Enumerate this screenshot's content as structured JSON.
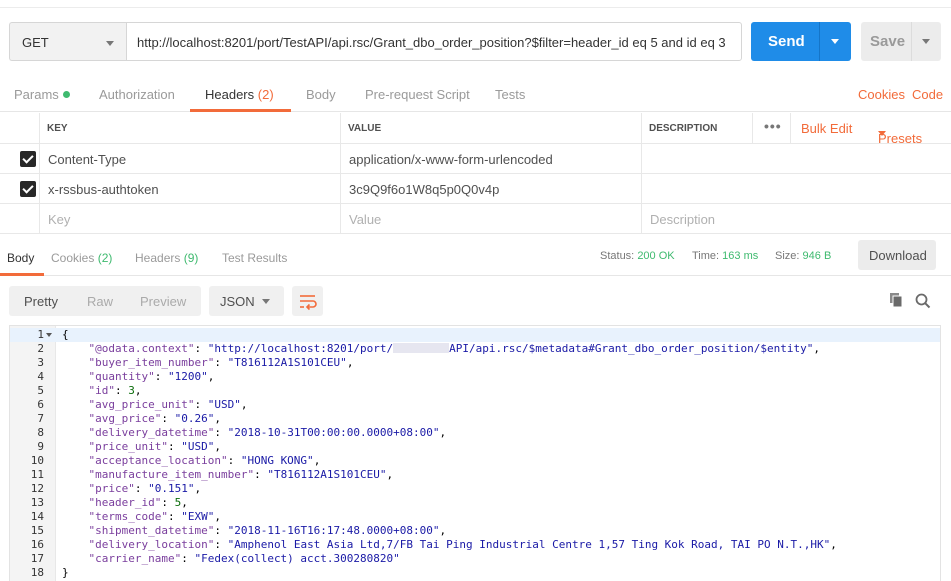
{
  "request": {
    "method": "GET",
    "url": "http://localhost:8201/port/TestAPI/api.rsc/Grant_dbo_order_position?$filter=header_id eq 5 and id eq 3",
    "send_label": "Send",
    "save_label": "Save"
  },
  "request_tabs": {
    "params": "Params",
    "authorization": "Authorization",
    "headers": "Headers",
    "headers_count": "(2)",
    "body": "Body",
    "prerequest": "Pre-request Script",
    "tests": "Tests",
    "cookies_link": "Cookies",
    "code_link": "Code",
    "params_dot_color": "#3fba6f",
    "accent": "#f26b3a"
  },
  "headers_table": {
    "columns": {
      "key": "KEY",
      "value": "VALUE",
      "description": "DESCRIPTION"
    },
    "more": "•••",
    "bulk_edit": "Bulk Edit",
    "presets": "Presets",
    "rows": [
      {
        "checked": true,
        "key": "Content-Type",
        "value": "application/x-www-form-urlencoded",
        "description": ""
      },
      {
        "checked": true,
        "key": "x-rssbus-authtoken",
        "value": "3c9Q9f6o1W8q5p0Q0v4p",
        "description": ""
      }
    ],
    "placeholder": {
      "key": "Key",
      "value": "Value",
      "description": "Description"
    }
  },
  "response": {
    "tabs": {
      "body": "Body",
      "cookies": "Cookies",
      "cookies_count": "(2)",
      "headers": "Headers",
      "headers_count": "(9)",
      "test_results": "Test Results"
    },
    "status_label": "Status:",
    "status_value": "200 OK",
    "time_label": "Time:",
    "time_value": "163 ms",
    "size_label": "Size:",
    "size_value": "946 B",
    "download_label": "Download"
  },
  "viewer": {
    "modes": [
      "Pretty",
      "Raw",
      "Preview"
    ],
    "active_mode": "Pretty",
    "format": "JSON",
    "icons": [
      "wrap-lines-icon",
      "copy-icon",
      "search-icon"
    ]
  },
  "body_lines": [
    {
      "n": "1",
      "text": "{"
    },
    {
      "n": "2",
      "key": "\"@odata.context\"",
      "val": "\"http://localhost:8201/port/",
      "val2": "API/api.rsc/$metadata#Grant_dbo_order_position/$entity\"",
      "redacted": true
    },
    {
      "n": "3",
      "key": "\"buyer_item_number\"",
      "val": "\"T816112A1S101CEU\""
    },
    {
      "n": "4",
      "key": "\"quantity\"",
      "val": "\"1200\""
    },
    {
      "n": "5",
      "key": "\"id\"",
      "num": "3"
    },
    {
      "n": "6",
      "key": "\"avg_price_unit\"",
      "val": "\"USD\""
    },
    {
      "n": "7",
      "key": "\"avg_price\"",
      "val": "\"0.26\""
    },
    {
      "n": "8",
      "key": "\"delivery_datetime\"",
      "val": "\"2018-10-31T00:00:00.0000+08:00\""
    },
    {
      "n": "9",
      "key": "\"price_unit\"",
      "val": "\"USD\""
    },
    {
      "n": "10",
      "key": "\"acceptance_location\"",
      "val": "\"HONG KONG\""
    },
    {
      "n": "11",
      "key": "\"manufacture_item_number\"",
      "val": "\"T816112A1S101CEU\""
    },
    {
      "n": "12",
      "key": "\"price\"",
      "val": "\"0.151\""
    },
    {
      "n": "13",
      "key": "\"header_id\"",
      "num": "5"
    },
    {
      "n": "14",
      "key": "\"terms_code\"",
      "val": "\"EXW\""
    },
    {
      "n": "15",
      "key": "\"shipment_datetime\"",
      "val": "\"2018-11-16T16:17:48.0000+08:00\""
    },
    {
      "n": "16",
      "key": "\"delivery_location\"",
      "val": "\"Amphenol East Asia Ltd,7/FB Tai Ping Industrial Centre 1,57 Ting Kok Road, TAI PO N.T.,HK\""
    },
    {
      "n": "17",
      "key": "\"carrier_name\"",
      "val": "\"Fedex(collect) acct.300280820\"",
      "last": true
    },
    {
      "n": "18",
      "text": "}"
    }
  ]
}
